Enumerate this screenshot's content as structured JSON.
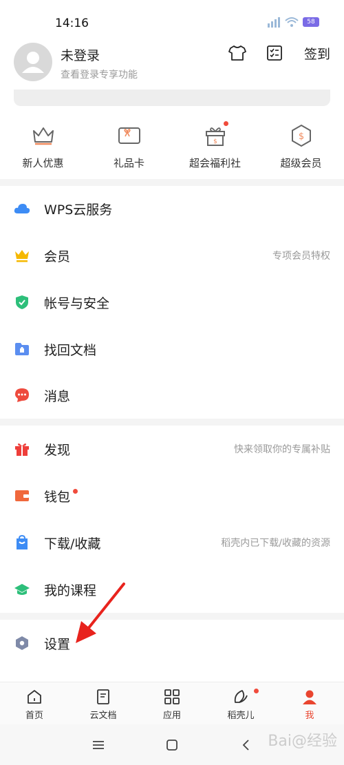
{
  "status": {
    "time": "14:16",
    "battery": "58"
  },
  "profile": {
    "name": "未登录",
    "subtitle": "查看登录专享功能"
  },
  "header": {
    "checkin_label": "签到"
  },
  "quick": [
    {
      "label": "新人优惠",
      "icon": "crown-icon"
    },
    {
      "label": "礼品卡",
      "icon": "gift-card-icon"
    },
    {
      "label": "超会福利社",
      "icon": "gift-box-icon"
    },
    {
      "label": "超级会员",
      "icon": "super-member-icon"
    }
  ],
  "menu": [
    {
      "label": "WPS云服务",
      "hint": "",
      "icon": "cloud-icon"
    },
    {
      "label": "会员",
      "hint": "专项会员特权",
      "icon": "crown-icon"
    },
    {
      "label": "帐号与安全",
      "hint": "",
      "icon": "shield-icon"
    },
    {
      "label": "找回文档",
      "hint": "",
      "icon": "folder-recover-icon"
    },
    {
      "label": "消息",
      "hint": "",
      "icon": "message-icon"
    },
    {
      "label": "发现",
      "hint": "快来领取你的专属补贴",
      "icon": "gift-icon"
    },
    {
      "label": "钱包",
      "hint": "",
      "icon": "wallet-icon"
    },
    {
      "label": "下载/收藏",
      "hint": "稻壳内已下载/收藏的资源",
      "icon": "shopping-bag-icon"
    },
    {
      "label": "我的课程",
      "hint": "",
      "icon": "graduation-cap-icon"
    },
    {
      "label": "设置",
      "hint": "",
      "icon": "settings-hexagon-icon"
    }
  ],
  "tabs": [
    {
      "label": "首页",
      "icon": "home-icon"
    },
    {
      "label": "云文档",
      "icon": "cloud-doc-icon"
    },
    {
      "label": "应用",
      "icon": "apps-grid-icon"
    },
    {
      "label": "稻壳儿",
      "icon": "leaf-icon"
    },
    {
      "label": "我",
      "icon": "person-icon"
    }
  ],
  "watermark": "Bai@经验",
  "colors": {
    "accent_red": "#e9452f",
    "cloud_blue": "#3d8cf5",
    "shield_green": "#2dbf7a",
    "gold": "#f5b800"
  }
}
